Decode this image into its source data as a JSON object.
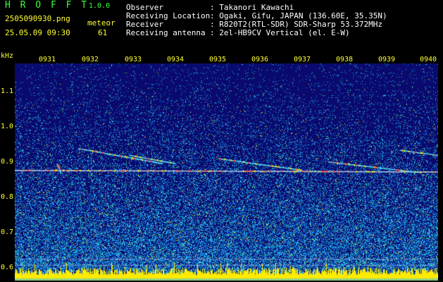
{
  "app": {
    "name": "H R O F F T",
    "version": "1.0.0"
  },
  "file": {
    "name": "2505090930.png",
    "timestamp": "25.05.09 09:30"
  },
  "meteor": {
    "label": "meteor",
    "count": "61"
  },
  "info": [
    {
      "label": "Observer",
      "value": ": Takanori Kawachi"
    },
    {
      "label": "Receiving Location",
      "value": ": Ogaki, Gifu, JAPAN (136.60E, 35.35N)"
    },
    {
      "label": "Receiver",
      "value": ": R820T2(RTL-SDR) SDR-Sharp 53.372MHz"
    },
    {
      "label": "Receiving antenna",
      "value": ": 2el-HB9CV Vertical (el. E-W)"
    }
  ],
  "axis": {
    "unit": "kHz",
    "time_ticks": [
      "0931",
      "0932",
      "0933",
      "0934",
      "0935",
      "0936",
      "0937",
      "0938",
      "0939",
      "0940"
    ],
    "freq_ticks": [
      "1.1",
      "1.0",
      "0.9",
      "0.8",
      "0.7",
      "0.6"
    ],
    "freq_range": [
      0.55,
      1.2
    ]
  },
  "colors": {
    "title": "#3cff3c",
    "meta": "#ffff33",
    "info": "#ffffff",
    "background": "#0a0a6e",
    "noise": "#19b4ff",
    "trace": "#ffeb00"
  },
  "meteor_traces": [
    {
      "t0": 0.0,
      "t1": 1.0,
      "f0": 0.88,
      "f1": 0.875
    },
    {
      "t0": 0.15,
      "t1": 0.35,
      "f0": 0.945,
      "f1": 0.9
    },
    {
      "t0": 0.27,
      "t1": 0.38,
      "f0": 0.925,
      "f1": 0.9
    },
    {
      "t0": 0.48,
      "t1": 0.68,
      "f0": 0.915,
      "f1": 0.88
    },
    {
      "t0": 0.74,
      "t1": 0.96,
      "f0": 0.905,
      "f1": 0.873
    },
    {
      "t0": 0.91,
      "t1": 1.0,
      "f0": 0.94,
      "f1": 0.925
    },
    {
      "t0": 0.1,
      "t1": 0.11,
      "f0": 0.9,
      "f1": 0.87
    }
  ]
}
